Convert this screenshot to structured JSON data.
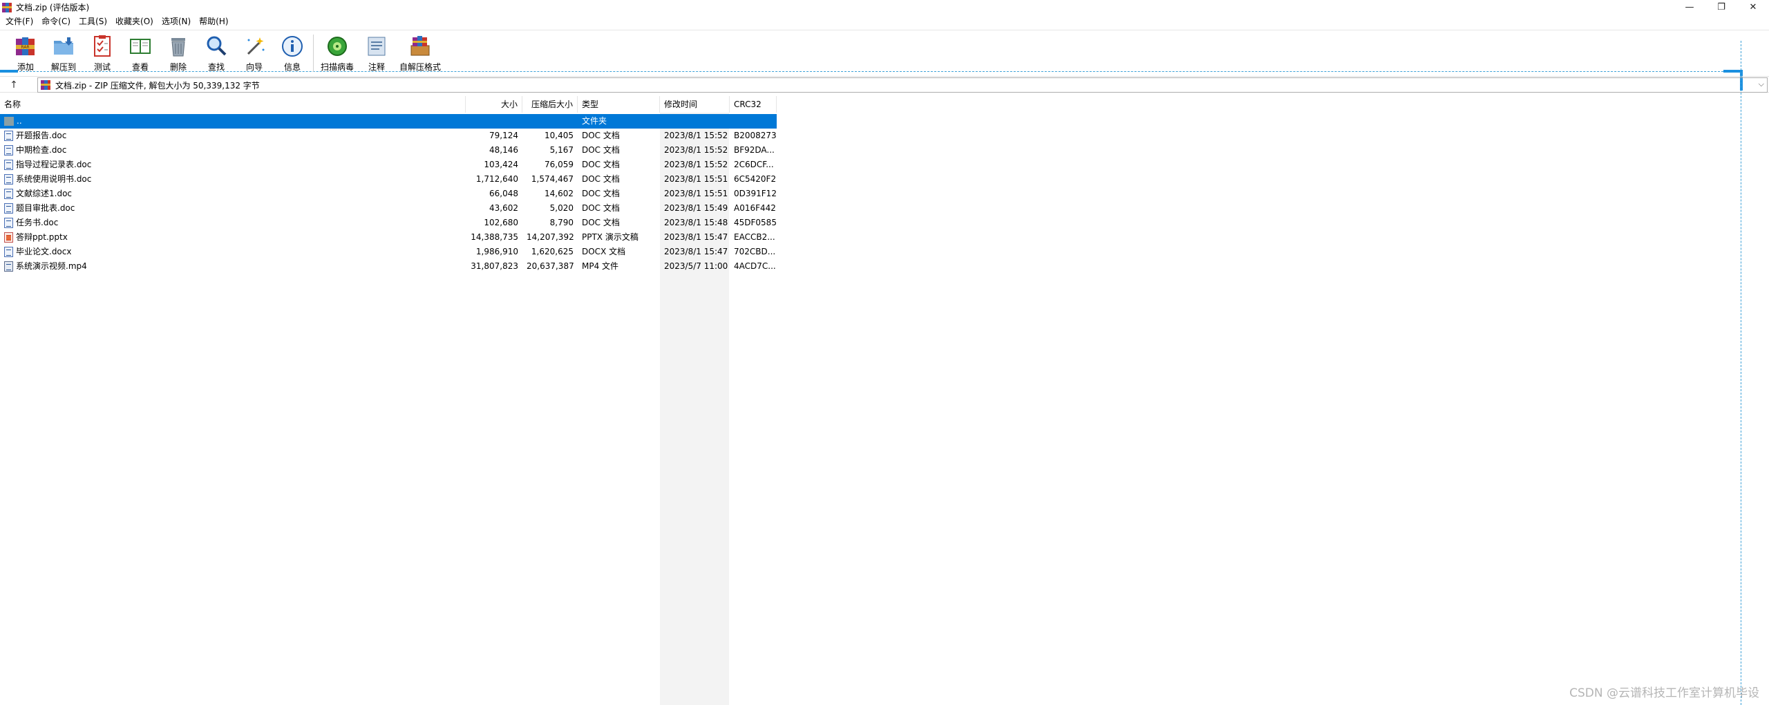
{
  "window": {
    "title": "文档.zip (评估版本)",
    "controls": {
      "minimize": "—",
      "restore": "❐",
      "close": "✕"
    }
  },
  "menu": [
    "文件(F)",
    "命令(C)",
    "工具(S)",
    "收藏夹(O)",
    "选项(N)",
    "帮助(H)"
  ],
  "toolbar": {
    "buttons": [
      {
        "label": "添加",
        "icon": "rar-books-icon"
      },
      {
        "label": "解压到",
        "icon": "folder-extract-icon"
      },
      {
        "label": "测试",
        "icon": "checklist-icon"
      },
      {
        "label": "查看",
        "icon": "open-book-icon"
      },
      {
        "label": "删除",
        "icon": "trash-icon"
      },
      {
        "label": "查找",
        "icon": "magnifier-icon"
      },
      {
        "label": "向导",
        "icon": "magic-wand-icon"
      },
      {
        "label": "信息",
        "icon": "info-icon"
      },
      {
        "label": "扫描病毒",
        "icon": "virus-scan-icon"
      },
      {
        "label": "注释",
        "icon": "comment-icon"
      },
      {
        "label": "自解压格式",
        "icon": "sfx-archive-icon"
      }
    ]
  },
  "address": {
    "up_icon": "↑",
    "path": "文档.zip - ZIP 压缩文件, 解包大小为 50,339,132 字节",
    "dropdown_icon": "⌵"
  },
  "columns": {
    "name": "名称",
    "size": "大小",
    "packed": "压缩后大小",
    "type": "类型",
    "mtime": "修改时间",
    "crc": "CRC32"
  },
  "files": [
    {
      "name": "..",
      "size": "",
      "packed": "",
      "type": "文件夹",
      "mtime": "",
      "crc": "",
      "kind": "folder",
      "selected": true
    },
    {
      "name": "开题报告.doc",
      "size": "79,124",
      "packed": "10,405",
      "type": "DOC 文档",
      "mtime": "2023/8/1 15:52",
      "crc": "B2008273",
      "kind": "doc"
    },
    {
      "name": "中期检查.doc",
      "size": "48,146",
      "packed": "5,167",
      "type": "DOC 文档",
      "mtime": "2023/8/1 15:52",
      "crc": "BF92DA...",
      "kind": "doc"
    },
    {
      "name": "指导过程记录表.doc",
      "size": "103,424",
      "packed": "76,059",
      "type": "DOC 文档",
      "mtime": "2023/8/1 15:52",
      "crc": "2C6DCF...",
      "kind": "doc"
    },
    {
      "name": "系统使用说明书.doc",
      "size": "1,712,640",
      "packed": "1,574,467",
      "type": "DOC 文档",
      "mtime": "2023/8/1 15:51",
      "crc": "6C5420F2",
      "kind": "doc"
    },
    {
      "name": "文献综述1.doc",
      "size": "66,048",
      "packed": "14,602",
      "type": "DOC 文档",
      "mtime": "2023/8/1 15:51",
      "crc": "0D391F12",
      "kind": "doc"
    },
    {
      "name": "题目审批表.doc",
      "size": "43,602",
      "packed": "5,020",
      "type": "DOC 文档",
      "mtime": "2023/8/1 15:49",
      "crc": "A016F442",
      "kind": "doc"
    },
    {
      "name": "任务书.doc",
      "size": "102,680",
      "packed": "8,790",
      "type": "DOC 文档",
      "mtime": "2023/8/1 15:48",
      "crc": "45DF0585",
      "kind": "doc"
    },
    {
      "name": "答辩ppt.pptx",
      "size": "14,388,735",
      "packed": "14,207,392",
      "type": "PPTX 演示文稿",
      "mtime": "2023/8/1 15:47",
      "crc": "EACCB2...",
      "kind": "pptx"
    },
    {
      "name": "毕业论文.docx",
      "size": "1,986,910",
      "packed": "1,620,625",
      "type": "DOCX 文档",
      "mtime": "2023/8/1 15:47",
      "crc": "702CBD...",
      "kind": "doc"
    },
    {
      "name": "系统演示视频.mp4",
      "size": "31,807,823",
      "packed": "20,637,387",
      "type": "MP4 文件",
      "mtime": "2023/5/7 11:00",
      "crc": "4ACD7C...",
      "kind": "mp4"
    }
  ],
  "watermark": "CSDN @云谱科技工作室计算机毕设",
  "colors": {
    "selection": "#0078d7",
    "accent_dash": "#3aa0d8"
  }
}
